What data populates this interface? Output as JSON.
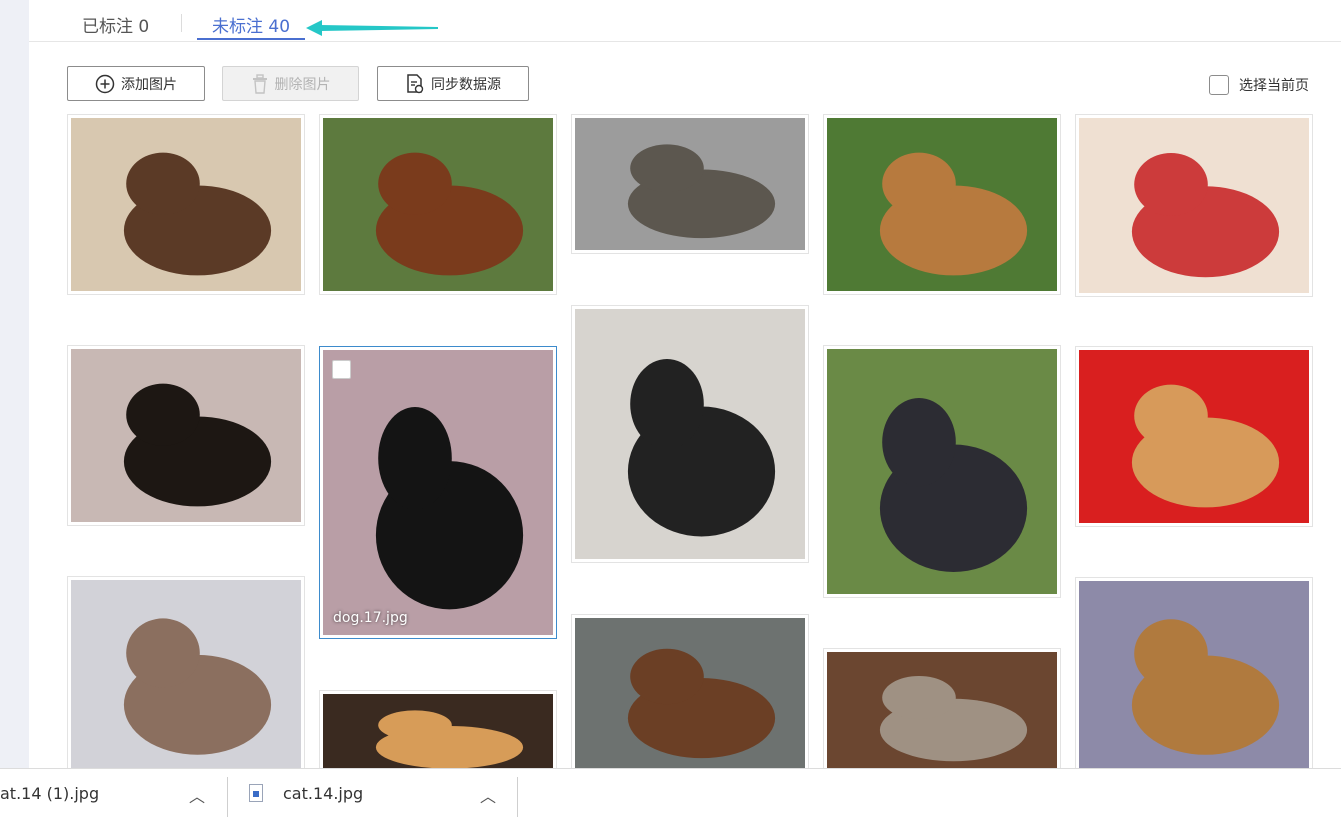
{
  "tabs": {
    "labeled": "已标注 0",
    "unlabeled": "未标注 40"
  },
  "toolbar": {
    "add": "添加图片",
    "delete": "删除图片",
    "sync": "同步数据源",
    "select_page": "选择当前页"
  },
  "colors": {
    "accent": "#4a6fd0",
    "arrow": "#25c7c7",
    "hover_border": "#3d8bcc"
  },
  "images": [
    {
      "name": "thumb-dog-1",
      "subject": "dog"
    },
    {
      "name": "thumb-dog-2",
      "subject": "dog"
    },
    {
      "name": "thumb-cat-1",
      "subject": "cat"
    },
    {
      "name": "thumb-dog-3",
      "subject": "dog"
    },
    {
      "name": "thumb-cat-2",
      "subject": "cat"
    },
    {
      "name": "thumb-dog-4",
      "subject": "dog"
    },
    {
      "name": "thumb-dog-17",
      "subject": "dog",
      "filename": "dog.17.jpg"
    },
    {
      "name": "thumb-dog-5",
      "subject": "dog"
    },
    {
      "name": "thumb-dog-6",
      "subject": "dog"
    },
    {
      "name": "thumb-cat-3",
      "subject": "cat"
    },
    {
      "name": "thumb-dog-7",
      "subject": "dog"
    },
    {
      "name": "thumb-cat-4",
      "subject": "cat"
    },
    {
      "name": "thumb-dog-8",
      "subject": "dog"
    },
    {
      "name": "thumb-cat-5",
      "subject": "cat"
    },
    {
      "name": "thumb-dog-9",
      "subject": "dog"
    }
  ],
  "downloads": [
    {
      "filename": "at.14 (1).jpg"
    },
    {
      "filename": "cat.14.jpg"
    }
  ]
}
